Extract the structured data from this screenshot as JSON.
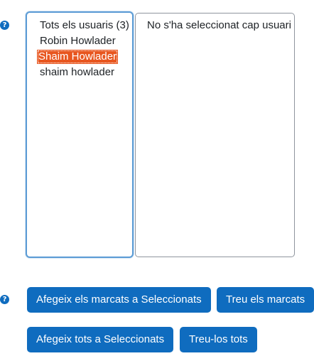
{
  "help_icon_glyph": "?",
  "available_list": {
    "items": [
      {
        "label": "Tots els usuaris (3)",
        "selected": false
      },
      {
        "label": "Robin Howlader",
        "selected": false
      },
      {
        "label": "Shaim Howlader",
        "selected": true
      },
      {
        "label": "shaim howlader",
        "selected": false
      }
    ]
  },
  "selected_list": {
    "empty_text": "No s'ha seleccionat cap usuari"
  },
  "buttons": {
    "add_marked": "Afegeix els marcats a Seleccionats",
    "remove_marked": "Treu els marcats",
    "add_all": "Afegeix tots a Seleccionats",
    "remove_all": "Treu-los tots"
  },
  "colors": {
    "accent": "#0f6cbf",
    "selection": "#e8561f",
    "focus_border": "#5b9bd5"
  },
  "icons": [
    "help-icon"
  ]
}
